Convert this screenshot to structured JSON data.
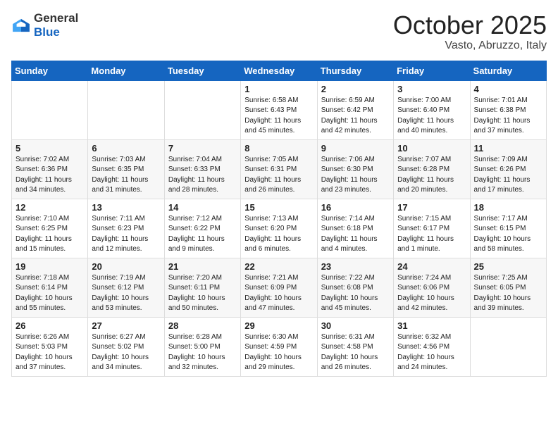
{
  "header": {
    "logo_general": "General",
    "logo_blue": "Blue",
    "month": "October 2025",
    "location": "Vasto, Abruzzo, Italy"
  },
  "days_of_week": [
    "Sunday",
    "Monday",
    "Tuesday",
    "Wednesday",
    "Thursday",
    "Friday",
    "Saturday"
  ],
  "weeks": [
    [
      {
        "day": "",
        "info": ""
      },
      {
        "day": "",
        "info": ""
      },
      {
        "day": "",
        "info": ""
      },
      {
        "day": "1",
        "info": "Sunrise: 6:58 AM\nSunset: 6:43 PM\nDaylight: 11 hours and 45 minutes."
      },
      {
        "day": "2",
        "info": "Sunrise: 6:59 AM\nSunset: 6:42 PM\nDaylight: 11 hours and 42 minutes."
      },
      {
        "day": "3",
        "info": "Sunrise: 7:00 AM\nSunset: 6:40 PM\nDaylight: 11 hours and 40 minutes."
      },
      {
        "day": "4",
        "info": "Sunrise: 7:01 AM\nSunset: 6:38 PM\nDaylight: 11 hours and 37 minutes."
      }
    ],
    [
      {
        "day": "5",
        "info": "Sunrise: 7:02 AM\nSunset: 6:36 PM\nDaylight: 11 hours and 34 minutes."
      },
      {
        "day": "6",
        "info": "Sunrise: 7:03 AM\nSunset: 6:35 PM\nDaylight: 11 hours and 31 minutes."
      },
      {
        "day": "7",
        "info": "Sunrise: 7:04 AM\nSunset: 6:33 PM\nDaylight: 11 hours and 28 minutes."
      },
      {
        "day": "8",
        "info": "Sunrise: 7:05 AM\nSunset: 6:31 PM\nDaylight: 11 hours and 26 minutes."
      },
      {
        "day": "9",
        "info": "Sunrise: 7:06 AM\nSunset: 6:30 PM\nDaylight: 11 hours and 23 minutes."
      },
      {
        "day": "10",
        "info": "Sunrise: 7:07 AM\nSunset: 6:28 PM\nDaylight: 11 hours and 20 minutes."
      },
      {
        "day": "11",
        "info": "Sunrise: 7:09 AM\nSunset: 6:26 PM\nDaylight: 11 hours and 17 minutes."
      }
    ],
    [
      {
        "day": "12",
        "info": "Sunrise: 7:10 AM\nSunset: 6:25 PM\nDaylight: 11 hours and 15 minutes."
      },
      {
        "day": "13",
        "info": "Sunrise: 7:11 AM\nSunset: 6:23 PM\nDaylight: 11 hours and 12 minutes."
      },
      {
        "day": "14",
        "info": "Sunrise: 7:12 AM\nSunset: 6:22 PM\nDaylight: 11 hours and 9 minutes."
      },
      {
        "day": "15",
        "info": "Sunrise: 7:13 AM\nSunset: 6:20 PM\nDaylight: 11 hours and 6 minutes."
      },
      {
        "day": "16",
        "info": "Sunrise: 7:14 AM\nSunset: 6:18 PM\nDaylight: 11 hours and 4 minutes."
      },
      {
        "day": "17",
        "info": "Sunrise: 7:15 AM\nSunset: 6:17 PM\nDaylight: 11 hours and 1 minute."
      },
      {
        "day": "18",
        "info": "Sunrise: 7:17 AM\nSunset: 6:15 PM\nDaylight: 10 hours and 58 minutes."
      }
    ],
    [
      {
        "day": "19",
        "info": "Sunrise: 7:18 AM\nSunset: 6:14 PM\nDaylight: 10 hours and 55 minutes."
      },
      {
        "day": "20",
        "info": "Sunrise: 7:19 AM\nSunset: 6:12 PM\nDaylight: 10 hours and 53 minutes."
      },
      {
        "day": "21",
        "info": "Sunrise: 7:20 AM\nSunset: 6:11 PM\nDaylight: 10 hours and 50 minutes."
      },
      {
        "day": "22",
        "info": "Sunrise: 7:21 AM\nSunset: 6:09 PM\nDaylight: 10 hours and 47 minutes."
      },
      {
        "day": "23",
        "info": "Sunrise: 7:22 AM\nSunset: 6:08 PM\nDaylight: 10 hours and 45 minutes."
      },
      {
        "day": "24",
        "info": "Sunrise: 7:24 AM\nSunset: 6:06 PM\nDaylight: 10 hours and 42 minutes."
      },
      {
        "day": "25",
        "info": "Sunrise: 7:25 AM\nSunset: 6:05 PM\nDaylight: 10 hours and 39 minutes."
      }
    ],
    [
      {
        "day": "26",
        "info": "Sunrise: 6:26 AM\nSunset: 5:03 PM\nDaylight: 10 hours and 37 minutes."
      },
      {
        "day": "27",
        "info": "Sunrise: 6:27 AM\nSunset: 5:02 PM\nDaylight: 10 hours and 34 minutes."
      },
      {
        "day": "28",
        "info": "Sunrise: 6:28 AM\nSunset: 5:00 PM\nDaylight: 10 hours and 32 minutes."
      },
      {
        "day": "29",
        "info": "Sunrise: 6:30 AM\nSunset: 4:59 PM\nDaylight: 10 hours and 29 minutes."
      },
      {
        "day": "30",
        "info": "Sunrise: 6:31 AM\nSunset: 4:58 PM\nDaylight: 10 hours and 26 minutes."
      },
      {
        "day": "31",
        "info": "Sunrise: 6:32 AM\nSunset: 4:56 PM\nDaylight: 10 hours and 24 minutes."
      },
      {
        "day": "",
        "info": ""
      }
    ]
  ]
}
